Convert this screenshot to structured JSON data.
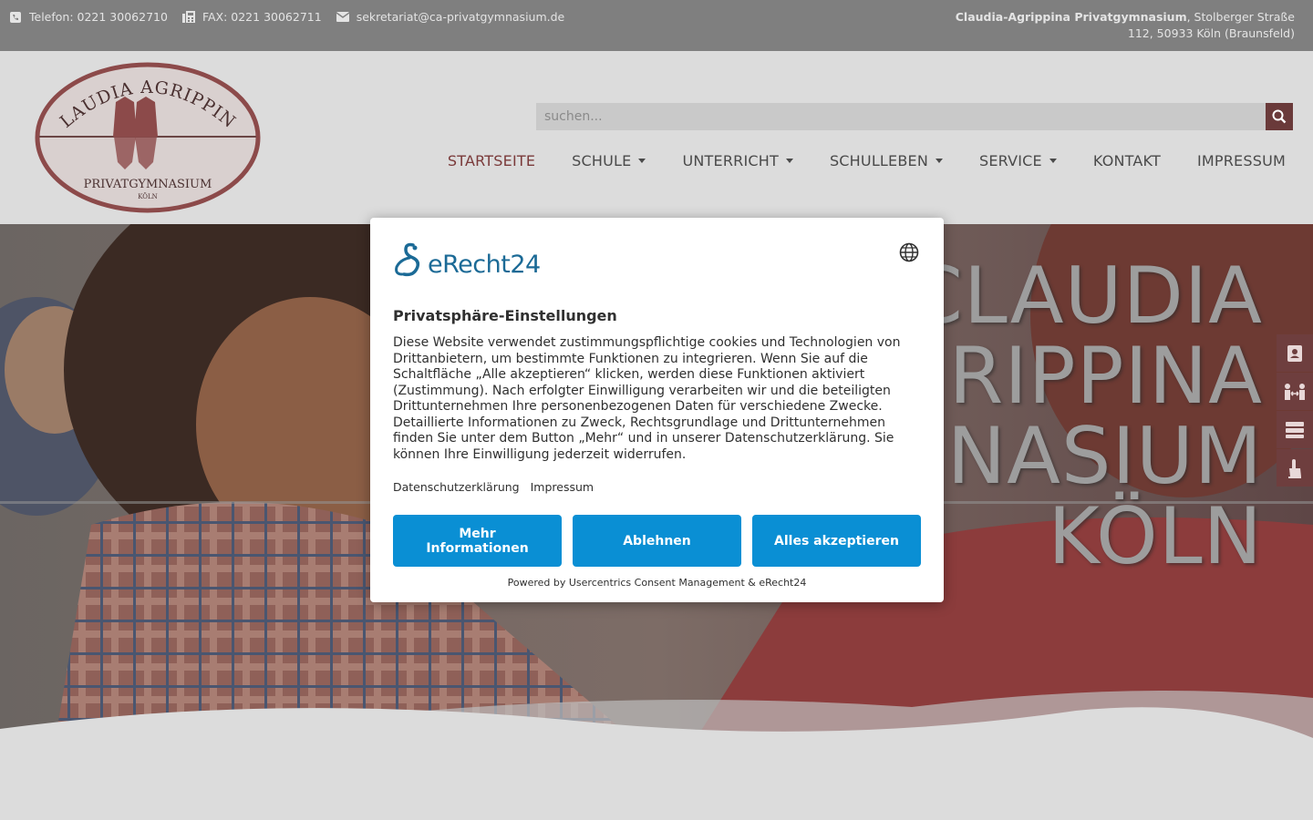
{
  "topbar": {
    "phone": "Telefon: 0221 30062710",
    "fax": "FAX: 0221 30062711",
    "email": "sekretariat@ca-privatgymnasium.de",
    "address_name": "Claudia-Agrippina Privatgymnasium",
    "address_rest": ", Stolberger Straße 112, 50933 Köln (Braunsfeld)"
  },
  "logo": {
    "line1": "CLAUDIA AGRIPPINA",
    "line2": "PRIVATGYMNASIUM",
    "line3": "KÖLN"
  },
  "search": {
    "placeholder": "suchen..."
  },
  "nav": {
    "items": [
      {
        "label": "STARTSEITE",
        "active": true
      },
      {
        "label": "SCHULE",
        "dropdown": true
      },
      {
        "label": "UNTERRICHT",
        "dropdown": true
      },
      {
        "label": "SCHULLEBEN",
        "dropdown": true
      },
      {
        "label": "SERVICE",
        "dropdown": true
      },
      {
        "label": "KONTAKT"
      },
      {
        "label": "IMPRESSUM"
      }
    ]
  },
  "hero": {
    "line1": "CLAUDIA",
    "line2": "RIPPINA",
    "line3": "NASIUM",
    "line4": "KÖLN"
  },
  "side_buttons": [
    "contact-card-icon",
    "people-arrows-icon",
    "server-icon",
    "hand-pointer-icon"
  ],
  "consent": {
    "brand": "eRecht24",
    "title": "Privatsphäre-Einstellungen",
    "description": "Diese Website verwendet zustimmungspflichtige cookies und Technologien von Drittanbietern, um bestimmte Funktionen zu integrieren. Wenn Sie auf die Schaltfläche „Alle akzeptieren“ klicken, werden diese Funktionen aktiviert (Zustimmung). Nach erfolgter Einwilligung verarbeiten wir und die beteiligten Drittunternehmen Ihre personenbezogenen Daten für verschiedene Zwecke. Detaillierte Informationen zu Zweck, Rechtsgrundlage und Drittunternehmen finden Sie unter dem Button „Mehr“ und in unserer Datenschutzerklärung. Sie können Ihre Einwilligung jederzeit widerrufen.",
    "link_privacy": "Datenschutzerklärung",
    "link_imprint": "Impressum",
    "btn_more": "Mehr Informationen",
    "btn_decline": "Ablehnen",
    "btn_accept": "Alles akzeptieren",
    "powered": "Powered by Usercentrics Consent Management & eRecht24"
  },
  "colors": {
    "topbar_bg": "#7f7f7f",
    "accent": "#7a3a3a",
    "consent_button": "#0a8fd4",
    "brand_blue": "#1b6a96"
  }
}
